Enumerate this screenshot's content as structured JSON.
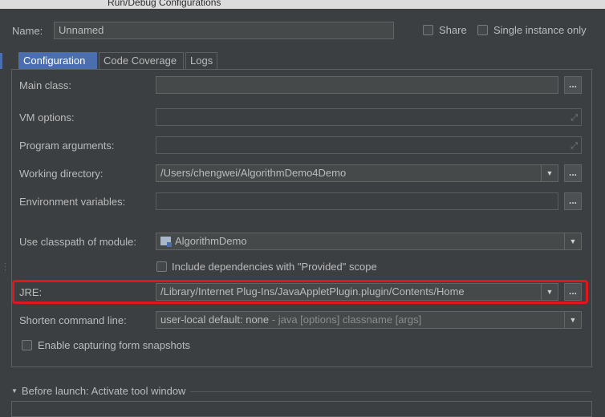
{
  "window": {
    "title": "Run/Debug Configurations"
  },
  "header": {
    "name_label": "Name:",
    "name_value": "Unnamed",
    "share_label": "Share",
    "single_instance_label": "Single instance only"
  },
  "tabs": [
    {
      "label": "Configuration",
      "active": true
    },
    {
      "label": "Code Coverage",
      "active": false
    },
    {
      "label": "Logs",
      "active": false
    }
  ],
  "form": {
    "main_class": {
      "label": "Main class:",
      "value": "",
      "browse": "..."
    },
    "vm_options": {
      "label": "VM options:",
      "value": ""
    },
    "program_arguments": {
      "label": "Program arguments:",
      "value": ""
    },
    "working_directory": {
      "label": "Working directory:",
      "value": "/Users/chengwei/AlgorithmDemo4Demo",
      "browse": "..."
    },
    "environment_variables": {
      "label": "Environment variables:",
      "value": "",
      "browse": "..."
    },
    "classpath_module": {
      "label": "Use classpath of module:",
      "value": "AlgorithmDemo"
    },
    "include_provided": {
      "label": "Include dependencies with \"Provided\" scope",
      "checked": false
    },
    "jre": {
      "label": "JRE:",
      "value": "/Library/Internet Plug-Ins/JavaAppletPlugin.plugin/Contents/Home",
      "browse": "..."
    },
    "shorten_command_line": {
      "label": "Shorten command line:",
      "value_main": "user-local default: none",
      "value_hint": " - java [options] classname [args]"
    },
    "capture_snapshots": {
      "label": "Enable capturing form snapshots",
      "checked": false
    }
  },
  "before_launch": {
    "label": "Before launch: Activate tool window"
  },
  "colors": {
    "highlight": "#e2151c",
    "active_tab": "#4b6eaf"
  }
}
